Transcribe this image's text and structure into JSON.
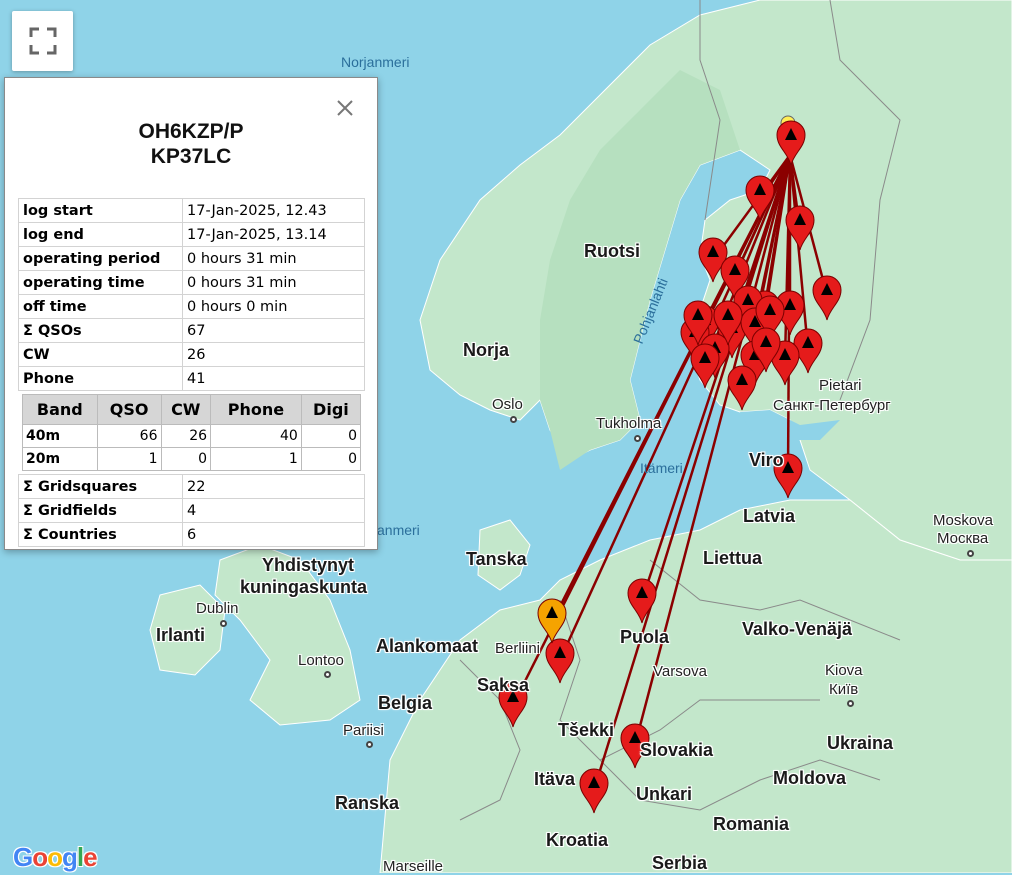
{
  "map": {
    "labels": {
      "norjanmeri": "Norjanmeri",
      "ruotsi": "Ruotsi",
      "norja": "Norja",
      "pohjanlahti": "Pohjanlahti",
      "oslo": "Oslo",
      "tukholma": "Tukholma",
      "itameri": "Itämeri",
      "pietari": "Pietari",
      "pietari_ru": "Санкт-Петербург",
      "viro": "Viro",
      "latvia": "Latvia",
      "moskova": "Moskova",
      "moskova_ru": "Москва",
      "liettua": "Liettua",
      "tanska": "Tanska",
      "pohjanmeri": "anmeri",
      "uk1": "Yhdistynyt",
      "uk2": "kuningaskunta",
      "dublin": "Dublin",
      "irlanti": "Irlanti",
      "alankomaat": "Alankomaat",
      "berliini": "Berliini",
      "puola": "Puola",
      "varsova": "Varsova",
      "valkovenaja": "Valko-Venäjä",
      "kiova": "Kiova",
      "kiova_uk": "Київ",
      "lontoo": "Lontoo",
      "belgia": "Belgia",
      "saksa": "Saksa",
      "tsekki": "Tšekki",
      "slovakia": "Slovakia",
      "ukraina": "Ukraina",
      "pariisi": "Pariisi",
      "itavalta": "Itäva",
      "unkari": "Unkari",
      "moldova": "Moldova",
      "ranska": "Ranska",
      "romania": "Romania",
      "kroatia": "Kroatia",
      "serbia": "Serbia",
      "marseille": "Marseille"
    },
    "colors": {
      "sea": "#8fd3e8",
      "land": "#bfe6c7",
      "line": "#8b0000",
      "marker": "#e51b1b",
      "marker_home": "#ffee55",
      "marker_orange": "#f5a300"
    }
  },
  "popup": {
    "callsign": "OH6KZP/P",
    "locator": "KP37LC",
    "rows": [
      {
        "key": "log start",
        "value": "17-Jan-2025, 12.43"
      },
      {
        "key": "log end",
        "value": "17-Jan-2025, 13.14"
      },
      {
        "key": "operating period",
        "value": "0 hours 31 min"
      },
      {
        "key": "operating time",
        "value": "0 hours 31 min"
      },
      {
        "key": "off time",
        "value": "0 hours 0 min"
      },
      {
        "key": "Σ QSOs",
        "value": "67"
      },
      {
        "key": "CW",
        "value": "26"
      },
      {
        "key": "Phone",
        "value": "41"
      }
    ],
    "band_headers": [
      "Band",
      "QSO",
      "CW",
      "Phone",
      "Digi"
    ],
    "bands": [
      [
        "40m",
        "66",
        "26",
        "40",
        "0"
      ],
      [
        "20m",
        "1",
        "0",
        "1",
        "0"
      ]
    ],
    "rows2": [
      {
        "key": "Σ Gridsquares",
        "value": "22"
      },
      {
        "key": "Σ Gridfields",
        "value": "4"
      },
      {
        "key": "Σ Countries",
        "value": "6"
      }
    ]
  },
  "branding": {
    "google": "Google"
  }
}
